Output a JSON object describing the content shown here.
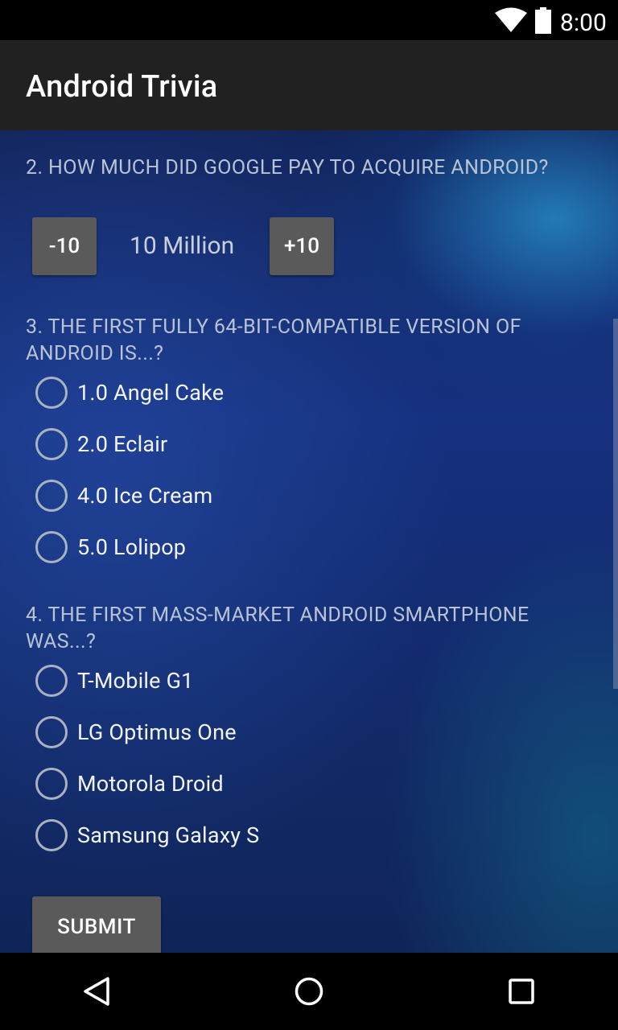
{
  "status_bar": {
    "time": "8:00",
    "icons": [
      "wifi-icon",
      "battery-icon"
    ]
  },
  "app_bar": {
    "title": "Android Trivia"
  },
  "questions": [
    {
      "text": "2. HOW MUCH DID GOOGLE PAY TO ACQUIRE ANDROID?",
      "stepper": {
        "decrement_label": "-10",
        "value": "10 Million",
        "increment_label": "+10"
      }
    },
    {
      "text": "3. THE FIRST FULLY 64-BIT-COMPATIBLE VERSION OF ANDROID IS...?",
      "options": [
        "1.0 Angel Cake",
        "2.0 Eclair",
        "4.0 Ice Cream",
        "5.0 Lolipop"
      ]
    },
    {
      "text": "4. THE FIRST MASS-MARKET ANDROID SMARTPHONE WAS...?",
      "options": [
        "T-Mobile G1",
        "LG Optimus One",
        "Motorola Droid",
        "Samsung Galaxy S"
      ]
    }
  ],
  "submit_label": "SUBMIT",
  "nav_bar": {
    "icons": [
      "back-icon",
      "home-icon",
      "recents-icon"
    ]
  },
  "colors": {
    "app_bar": "#212121",
    "button": "#5a5a5a",
    "question_text": "#b9c3d6",
    "option_text": "#f2f4f8"
  }
}
